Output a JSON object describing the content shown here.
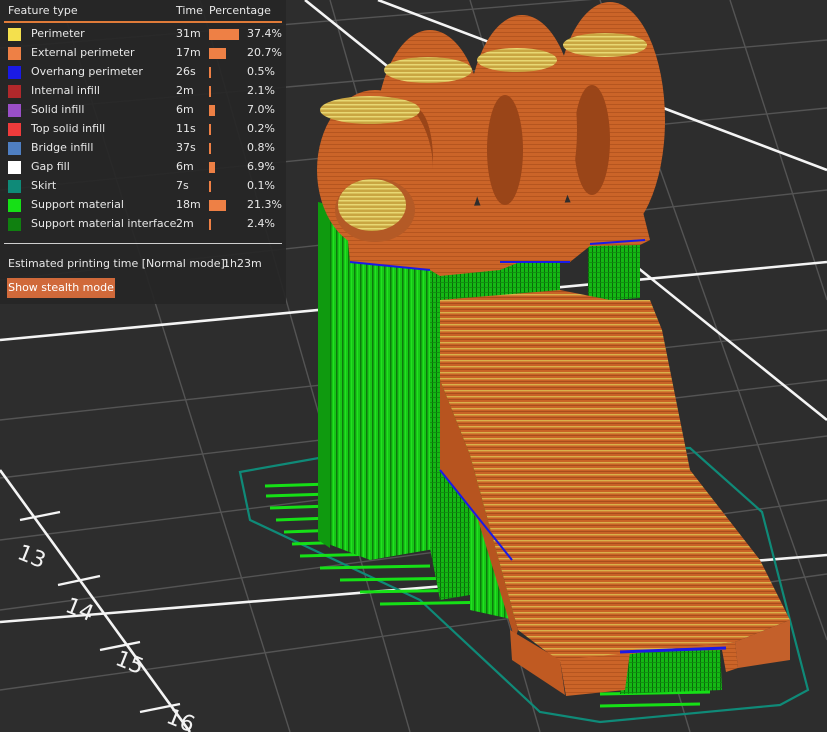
{
  "legend": {
    "headers": {
      "feature": "Feature type",
      "time": "Time",
      "percentage": "Percentage"
    },
    "rows": [
      {
        "name": "Perimeter",
        "time": "31m",
        "percent": "37.4%",
        "color": "#f4e04d",
        "value": 37.4
      },
      {
        "name": "External perimeter",
        "time": "17m",
        "percent": "20.7%",
        "color": "#ee8045",
        "value": 20.7
      },
      {
        "name": "Overhang perimeter",
        "time": "26s",
        "percent": "0.5%",
        "color": "#1a1ae6",
        "value": 0.5
      },
      {
        "name": "Internal infill",
        "time": "2m",
        "percent": "2.1%",
        "color": "#b0282b",
        "value": 2.1
      },
      {
        "name": "Solid infill",
        "time": "6m",
        "percent": "7.0%",
        "color": "#9a4fc7",
        "value": 7.0
      },
      {
        "name": "Top solid infill",
        "time": "11s",
        "percent": "0.2%",
        "color": "#ef3b3b",
        "value": 0.2
      },
      {
        "name": "Bridge infill",
        "time": "37s",
        "percent": "0.8%",
        "color": "#4f7fc2",
        "value": 0.8
      },
      {
        "name": "Gap fill",
        "time": "6m",
        "percent": "6.9%",
        "color": "#ffffff",
        "value": 6.9
      },
      {
        "name": "Skirt",
        "time": "7s",
        "percent": "0.1%",
        "color": "#0f8a78",
        "value": 0.1
      },
      {
        "name": "Support material",
        "time": "18m",
        "percent": "21.3%",
        "color": "#16e016",
        "value": 21.3
      },
      {
        "name": "Support material interface",
        "time": "2m",
        "percent": "2.4%",
        "color": "#108010",
        "value": 2.4
      }
    ],
    "estimated_label": "Estimated printing time [Normal mode]:",
    "estimated_value": "1h23m",
    "stealth_button": "Show stealth mode"
  },
  "bed": {
    "ruler_labels": [
      "13",
      "14",
      "15",
      "16"
    ]
  }
}
